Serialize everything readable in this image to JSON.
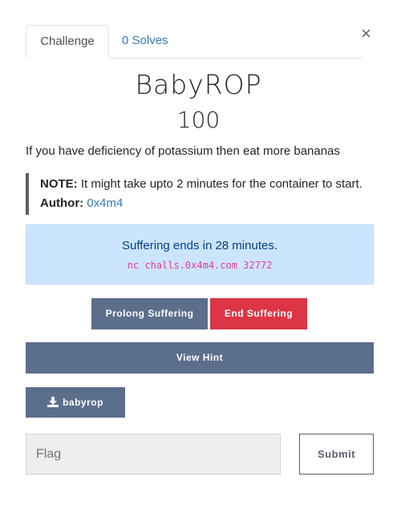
{
  "modal": {
    "close_glyph": "×"
  },
  "tabs": {
    "challenge": "Challenge",
    "solves": "0 Solves"
  },
  "challenge": {
    "name": "BabyROP",
    "points": "100",
    "description": "If you have deficiency of potassium then eat more bananas",
    "note_label": "NOTE:",
    "note_text": " It might take upto 2 minutes for the container to start. ",
    "author_label": "Author:",
    "author_name": "0x4m4"
  },
  "instance": {
    "status_message": "Suffering ends in 28 minutes.",
    "connection": "nc challs.0x4m4.com 32772"
  },
  "buttons": {
    "prolong": "Prolong Suffering",
    "end": "End Suffering",
    "hint": "View Hint",
    "file": "babyrop",
    "file_icon": "download-icon",
    "submit": "Submit"
  },
  "flag": {
    "placeholder": "Flag",
    "value": ""
  },
  "colors": {
    "primary_button": "#5b6f8c",
    "danger_button": "#dc3545",
    "alert_bg": "#cce5ff",
    "alert_text": "#004085",
    "code_text": "#e83e8c",
    "link": "#337ab7"
  }
}
